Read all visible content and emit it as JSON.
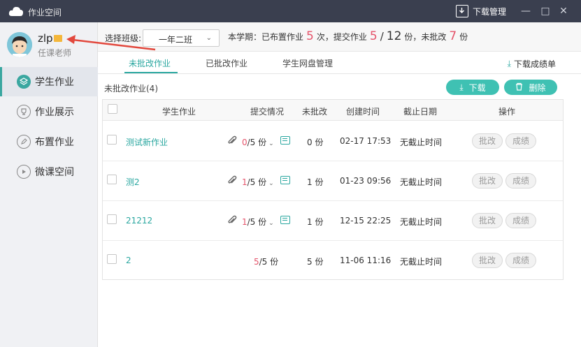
{
  "window": {
    "title": "作业空间",
    "download_manager": "下载管理"
  },
  "user": {
    "name": "zlp",
    "role": "任课老师"
  },
  "sidebar": {
    "items": [
      {
        "label": "学生作业",
        "icon": "layers-icon",
        "active": true
      },
      {
        "label": "作业展示",
        "icon": "trophy-icon",
        "active": false
      },
      {
        "label": "布置作业",
        "icon": "edit-icon",
        "active": false
      },
      {
        "label": "微课空间",
        "icon": "play-icon",
        "active": false
      }
    ]
  },
  "toolbar": {
    "class_label": "选择班级:",
    "class_value": "一年二班",
    "stats": {
      "prefix": "本学期：已布置作业",
      "assigned": "5",
      "assigned_unit": "次，提交作业",
      "submitted": "5",
      "slash": "/",
      "total": "12",
      "total_unit": "份，未批改",
      "unmarked": "7",
      "unmarked_unit": "份"
    }
  },
  "tabs": [
    {
      "label": "未批改作业",
      "active": true
    },
    {
      "label": "已批改作业",
      "active": false
    },
    {
      "label": "学生网盘管理",
      "active": false
    }
  ],
  "download_report": "下载成绩单",
  "list": {
    "title": "未批改作业(4)",
    "download_label": "下载",
    "delete_label": "删除",
    "columns": [
      "学生作业",
      "提交情况",
      "未批改",
      "创建时间",
      "截止日期",
      "操作"
    ],
    "rows": [
      {
        "name": "测试新作业",
        "submitted": "0",
        "total": "/5 份",
        "unmarked": "0 份",
        "created": "02-17 17:53",
        "deadline": "无截止时间",
        "action1": "批改",
        "action2": "成绩",
        "has_attach": true
      },
      {
        "name": "测2",
        "submitted": "1",
        "total": "/5 份",
        "unmarked": "1 份",
        "created": "01-23 09:56",
        "deadline": "无截止时间",
        "action1": "批改",
        "action2": "成绩",
        "has_attach": true
      },
      {
        "name": "21212",
        "submitted": "1",
        "total": "/5 份",
        "unmarked": "1 份",
        "created": "12-15 22:25",
        "deadline": "无截止时间",
        "action1": "批改",
        "action2": "成绩",
        "has_attach": true
      },
      {
        "name": "2",
        "submitted": "5",
        "total": "/5 份",
        "unmarked": "5 份",
        "created": "11-06 11:16",
        "deadline": "无截止时间",
        "action1": "批改",
        "action2": "成绩",
        "has_attach": false
      }
    ]
  },
  "colors": {
    "accent": "#2aa7a0",
    "highlight": "#e5546b",
    "titlebar": "#3a3f4f",
    "arrow": "#e2483d"
  }
}
